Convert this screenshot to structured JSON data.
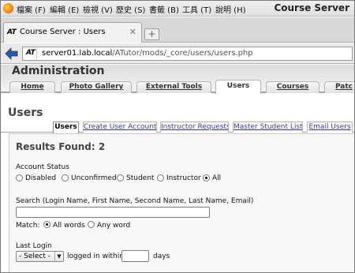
{
  "window": {
    "title": "Course Server"
  },
  "menubar": {
    "items": [
      "檔案 (F)",
      "編輯 (E)",
      "檢視 (V)",
      "歷史 (S)",
      "書籤 (B)",
      "工具 (T)",
      "說明 (H)"
    ]
  },
  "browser_tab": {
    "logo": "AT",
    "title": "Course Server : Users",
    "close_icon": "close-icon",
    "new_tab": "+"
  },
  "navbar": {
    "logo": "AT",
    "url_host": "server01.lab.local",
    "url_path": "/ATutor/mods/_core/users/users.php"
  },
  "header": {
    "title": "Administration",
    "tabs": [
      "Home",
      "Photo Gallery",
      "External Tools",
      "Users",
      "Courses",
      "Patc"
    ],
    "active_tab": "Users"
  },
  "page": {
    "title": "Users",
    "subtabs": [
      "Users",
      "Create User Account",
      "Instructor Requests",
      "Master Student List",
      "Email Users"
    ],
    "active_subtab": "Users"
  },
  "filter": {
    "results_label": "Results Found: 2",
    "account_status": {
      "label": "Account Status",
      "options": [
        "Disabled",
        "Unconfirmed",
        "Student",
        "Instructor",
        "All"
      ],
      "selected": "All"
    },
    "search": {
      "label": "Search (Login Name, First Name, Second Name, Last Name, Email)",
      "value": "",
      "match_label": "Match:",
      "match_options": [
        "All words",
        "Any word"
      ],
      "match_selected": "All words"
    },
    "last_login": {
      "label": "Last Login",
      "select_value": "- Select -",
      "logged_in_label": "logged in within:",
      "days_value": "",
      "days_label": "days"
    }
  },
  "colors": {
    "firefox_orange": "#f28a1b",
    "link_blue": "#3a3a8a",
    "title_grey": "#444444"
  }
}
